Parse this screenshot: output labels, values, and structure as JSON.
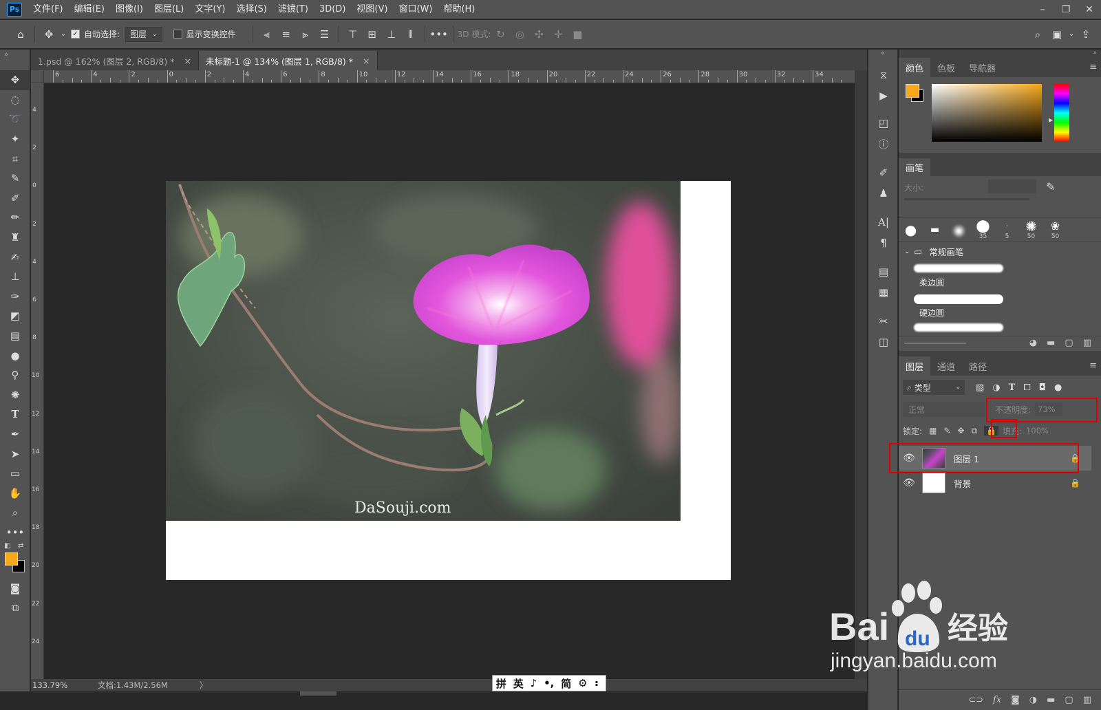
{
  "app": {
    "logo": "Ps",
    "accent": "#31a8ff"
  },
  "menu": [
    "文件(F)",
    "编辑(E)",
    "图像(I)",
    "图层(L)",
    "文字(Y)",
    "选择(S)",
    "滤镜(T)",
    "3D(D)",
    "视图(V)",
    "窗口(W)",
    "帮助(H)"
  ],
  "window_controls": [
    "–",
    "❐",
    "✕"
  ],
  "options": {
    "auto_select_label": "自动选择:",
    "auto_select_target": "图层",
    "show_transform_label": "显示变换控件",
    "mode_3d_label": "3D 模式:"
  },
  "doc_tabs": [
    {
      "label": "1.psd @ 162% (图层 2, RGB/8) *",
      "active": false,
      "close": "×"
    },
    {
      "label": "未标题-1 @ 134% (图层 1, RGB/8) *",
      "active": true,
      "close": "×"
    }
  ],
  "ruler": {
    "top_labels": [
      "6",
      "4",
      "2",
      "0",
      "2",
      "4",
      "6",
      "8",
      "10",
      "12",
      "14",
      "16",
      "18",
      "20",
      "22",
      "24",
      "26",
      "28",
      "30",
      "32",
      "34"
    ],
    "left_labels": [
      "4",
      "2",
      "0",
      "2",
      "4",
      "6",
      "8",
      "10",
      "12",
      "14",
      "16",
      "18",
      "20",
      "22",
      "24"
    ]
  },
  "status": {
    "zoom": "133.79%",
    "doc": "文档:1.43M/2.56M",
    "arrow": "〉"
  },
  "ime": [
    "拼",
    "英",
    "♪",
    "•,",
    "简",
    "⚙",
    "⠆"
  ],
  "image": {
    "watermark_text": "DaSouji.com"
  },
  "colors": {
    "foreground": "#f7a81b",
    "background": "#000000"
  },
  "color_panel": {
    "tabs": [
      "颜色",
      "色板",
      "导航器"
    ],
    "menu": "≡"
  },
  "brush_panel": {
    "tab": "画笔",
    "size_label": "大小:",
    "presets": [
      "",
      "",
      "",
      "35",
      "5",
      "50",
      "50"
    ],
    "group_name": "常规画笔",
    "brushes": [
      "柔边圆",
      "硬边圆"
    ]
  },
  "layers_panel": {
    "tabs": [
      "图层",
      "通道",
      "路径"
    ],
    "filter_label": "类型",
    "blend_mode": "正常",
    "opacity_label": "不透明度:",
    "opacity_value": "73%",
    "lock_label": "锁定:",
    "fill_label": "填充:",
    "fill_value": "100%",
    "layers": [
      {
        "name": "图层 1",
        "selected": true,
        "visible": true,
        "locked": true
      },
      {
        "name": "背景",
        "selected": false,
        "visible": true,
        "locked": true
      }
    ],
    "footer_icons": [
      "link-icon",
      "fx-icon",
      "mask-icon",
      "adjustment-icon",
      "folder-icon",
      "new-layer-icon",
      "trash-icon"
    ]
  },
  "baidu_watermark": {
    "brand": "Bai",
    "paw_text": "du",
    "label": "经验",
    "url": "jingyan.baidu.com"
  }
}
